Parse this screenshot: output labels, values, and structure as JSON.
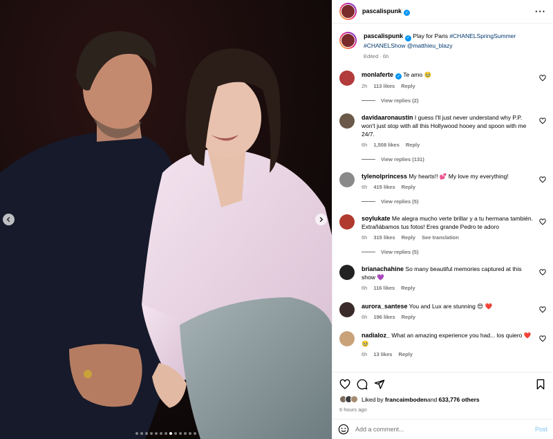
{
  "post": {
    "author": "pascalispunk",
    "caption_text": "Play for Paris ",
    "caption_tags": "#CHANELSpringSummer #CHANELShow @matthieu_blazy",
    "caption_meta": "Edited · 6h"
  },
  "carousel": {
    "dot_count": 13,
    "active_index": 7
  },
  "comments": [
    {
      "user": "monlaferte",
      "verified": true,
      "text": "Te amo 🥹",
      "time": "2h",
      "likes": "113 likes",
      "reply": "Reply",
      "extra": "",
      "view_replies": "View replies (2)",
      "avatar_color": "#b23b3b"
    },
    {
      "user": "davidaaronaustin",
      "verified": false,
      "text": "I guess I'll just never understand why P.P. won't just stop with all this Hollywood hooey and spoon with me 24/7.",
      "time": "6h",
      "likes": "1,508 likes",
      "reply": "Reply",
      "extra": "",
      "view_replies": "View replies (131)",
      "avatar_color": "#6b5a4a"
    },
    {
      "user": "tylenolprincess",
      "verified": false,
      "text": "My hearts!! 💕 My love my everything!",
      "time": "6h",
      "likes": "415 likes",
      "reply": "Reply",
      "extra": "",
      "view_replies": "View replies (5)",
      "avatar_color": "#8a8a8a"
    },
    {
      "user": "soylukate",
      "verified": false,
      "text": "Me alegra mucho verte brillar y a tu hermana también. Extrañábamos tus fotos! Eres grande Pedro te adoro",
      "time": "6h",
      "likes": "315 likes",
      "reply": "Reply",
      "extra": "See translation",
      "view_replies": "View replies (5)",
      "avatar_color": "#b03a2e"
    },
    {
      "user": "brianachahine",
      "verified": false,
      "text": "So many beautiful memories captured at this show 💜",
      "time": "6h",
      "likes": "116 likes",
      "reply": "Reply",
      "extra": "",
      "view_replies": "",
      "avatar_color": "#222222"
    },
    {
      "user": "aurora_santese",
      "verified": false,
      "text": "You and Lux are stunning 😍 ❤️",
      "time": "6h",
      "likes": "196 likes",
      "reply": "Reply",
      "extra": "",
      "view_replies": "",
      "avatar_color": "#3a2a2a"
    },
    {
      "user": "nadialoz_",
      "verified": false,
      "text": "What an amazing experience you had... los quiero ❤️ 🥹",
      "time": "6h",
      "likes": "13 likes",
      "reply": "Reply",
      "extra": "",
      "view_replies": "",
      "avatar_color": "#c9a27a"
    }
  ],
  "engagement": {
    "liked_by_prefix": "Liked by ",
    "liked_by_user": "francaimboden",
    "and_label": " and ",
    "others": "633,776 others",
    "time_ago": "6 hours ago"
  },
  "composer": {
    "placeholder": "Add a comment...",
    "post_label": "Post"
  },
  "icons": {
    "more": "more-options-icon",
    "heart": "heart-icon",
    "comment": "comment-icon",
    "share": "share-icon",
    "save": "bookmark-icon",
    "emoji": "emoji-icon",
    "prev": "chevron-left-icon",
    "next": "chevron-right-icon"
  },
  "colors": {
    "link": "#00376b",
    "verified": "#0095f6",
    "muted": "#737373",
    "post_button": "#7cc3f5"
  }
}
